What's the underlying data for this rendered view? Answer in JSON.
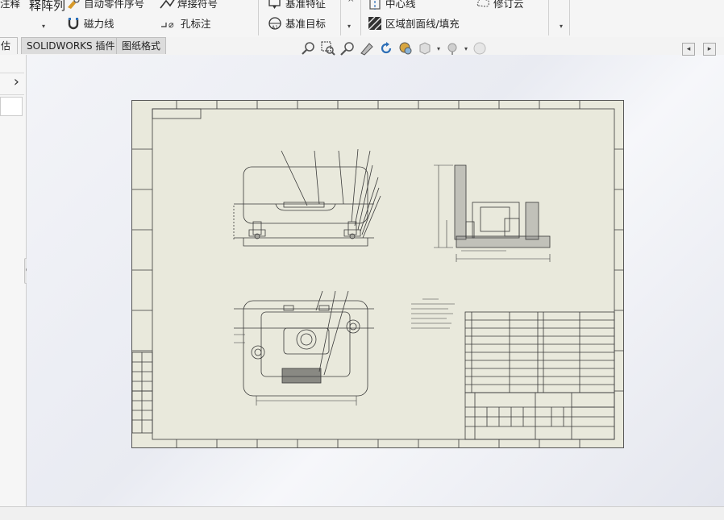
{
  "ribbon": {
    "annotation_label": "注释",
    "pattern_label": "释阵列",
    "auto_balloon_label": "自动零件序号",
    "weld_symbol_label": "焊接符号",
    "datum_feature_label": "基准特征",
    "centerline_label": "中心线",
    "revision_cloud_label": "修订云",
    "magnetic_line_label": "磁力线",
    "hole_callout_label": "孔标注",
    "datum_target_label": "基准目标",
    "area_hatch_label": "区域剖面线/填充",
    "hole_callout_prefix": "⌀"
  },
  "tabs": [
    {
      "label": "估"
    },
    {
      "label": "SOLIDWORKS 插件"
    },
    {
      "label": "图纸格式"
    }
  ],
  "icons": {
    "panel_expand": "›",
    "ribbon_dropdown": "▾",
    "ribbon_collapse": "^",
    "scroll_left": "◂",
    "scroll_right": "▸"
  },
  "colors": {
    "sheet_bg": "#e9e9dc",
    "line": "#3a3a3a",
    "ribbon_bg": "#f5f5f5",
    "accent_blue": "#2d6fb7"
  }
}
